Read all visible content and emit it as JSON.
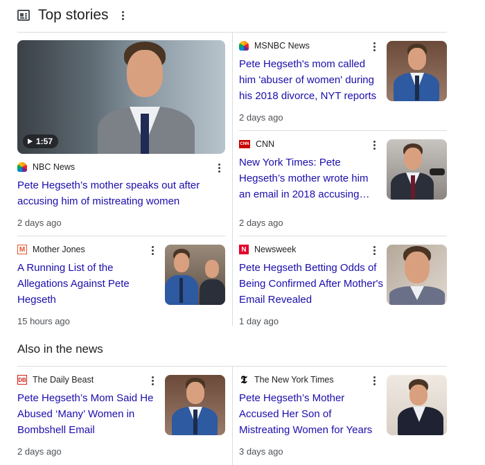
{
  "header": {
    "title": "Top stories",
    "icon": "news-icon"
  },
  "top_stories": [
    {
      "source": "NBC News",
      "logo": "nbc-logo",
      "headline": "Pete Hegseth’s mother speaks out after accusing him of mistreating women",
      "time": "2 days ago",
      "duration": "1:57"
    },
    {
      "source": "MSNBC News",
      "logo": "nbc-logo",
      "headline": "Pete Hegseth's mom called him 'abuser of women' during his 2018 divorce, NYT reports",
      "time": "2 days ago"
    },
    {
      "source": "CNN",
      "logo": "cnn-logo",
      "logo_text": "CNN",
      "headline": "New York Times: Pete Hegseth’s mother wrote him an email in 2018 accusing…",
      "time": "2 days ago"
    },
    {
      "source": "Mother Jones",
      "logo": "mother-jones-logo",
      "logo_text": "M",
      "headline": "A Running List of the Allegations Against Pete Hegseth",
      "time": "15 hours ago"
    },
    {
      "source": "Newsweek",
      "logo": "newsweek-logo",
      "logo_text": "N",
      "headline": "Pete Hegseth Betting Odds of Being Confirmed After Mother's Email Revealed",
      "time": "1 day ago"
    }
  ],
  "also_in_news": {
    "title": "Also in the news",
    "items": [
      {
        "source": "The Daily Beast",
        "logo": "daily-beast-logo",
        "logo_text": "DB",
        "headline": "Pete Hegseth’s Mom Said He Abused ‘Many’ Women in Bombshell Email",
        "time": "2 days ago"
      },
      {
        "source": "The New York Times",
        "logo": "nyt-logo",
        "logo_text": "𝕿",
        "headline": "Pete Hegseth’s Mother Accused Her Son of Mistreating Women for Years",
        "time": "3 days ago"
      }
    ]
  },
  "colors": {
    "link": "#1a0dab",
    "meta": "#4d5156",
    "divider": "#dadce0"
  }
}
